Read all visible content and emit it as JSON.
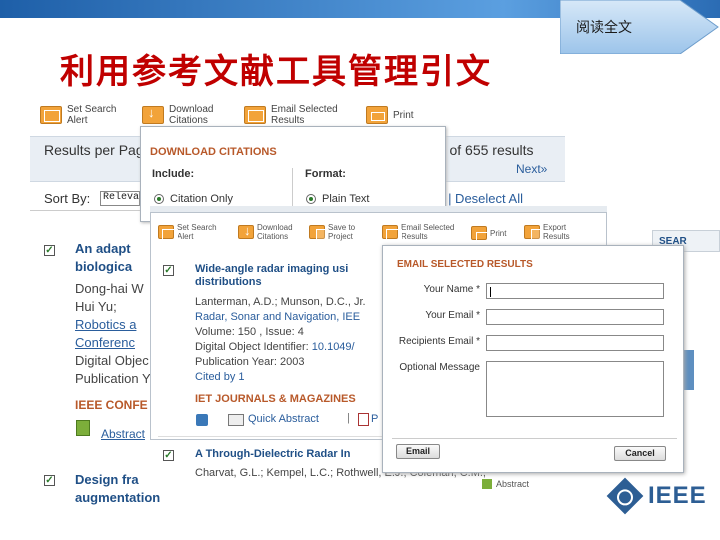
{
  "slide": {
    "title": "利用参考文献工具管理引文",
    "corner_link": "阅读全文"
  },
  "toolbar": {
    "set_search_alert": [
      "Set Search",
      "Alert"
    ],
    "download_citations": [
      "Download",
      "Citations"
    ],
    "email_selected": [
      "Email Selected",
      "Results"
    ],
    "print": "Print"
  },
  "results": {
    "per_page_label": "Results per Pag",
    "count_text": "25 of 655 results",
    "next": "Next»",
    "sort_label": "Sort By:",
    "sort_value": "Releva",
    "select_links_tail": "ge |  Deselect All",
    "items": [
      {
        "title_lines": [
          "An adapt",
          "biologica"
        ],
        "lines": [
          "Dong-hai W",
          "Hui Yu;"
        ],
        "links": [
          "Robotics a",
          "Conferenc"
        ],
        "extra": [
          "Digital Objec",
          "Publication Y"
        ],
        "conf": "IEEE CONFE",
        "abstract": "Abstract"
      },
      {
        "title_lines": [
          "Design fra",
          "augmentation"
        ],
        "abstract": "Abstract"
      }
    ]
  },
  "download_popup": {
    "heading": "DOWNLOAD CITATIONS",
    "include_label": "Include:",
    "format_label": "Format:",
    "include_value": "Citation Only",
    "format_value": "Plain Text"
  },
  "layer2": {
    "toolbar": {
      "set_search_alert": [
        "Set Search",
        "Alert"
      ],
      "download_citations": [
        "Download",
        "Citations"
      ],
      "save_to_project": [
        "Save to",
        "Project"
      ],
      "email_selected": [
        "Email Selected",
        "Results"
      ],
      "print": "Print",
      "export_results": [
        "Export",
        "Results"
      ]
    },
    "item1": {
      "title_lines": [
        "Wide-angle radar imaging usi",
        "distributions"
      ],
      "authors": "Lanterman, A.D.; Munson, D.C., Jr.",
      "journal": "Radar, Sonar and Navigation, IEE",
      "volume": "Volume: 150 , Issue: 4",
      "doi_label": "Digital Object Identifier: ",
      "doi_value": "10.1049/",
      "pubyear": "Publication Year: 2003",
      "cited": "Cited by 1",
      "journals": "IET JOURNALS & MAGAZINES",
      "quick_abstract": "Quick Abstract",
      "pdf_tail": "P"
    },
    "item2": {
      "title": "A Through-Dielectric Radar In",
      "authors": "Charvat, G.L.; Kempel, L.C.; Rothwell, E.J.; Coleman, C.M.;",
      "abstract_tail": "Abstract"
    },
    "search_tab": "SEAR"
  },
  "email_popup": {
    "heading": "EMAIL SELECTED RESULTS",
    "your_name_label": "Your Name *",
    "your_email_label": "Your Email *",
    "recipients_label": "Recipients Email *",
    "optional_label": "Optional Message",
    "email_button": "Email",
    "cancel_button": "Cancel"
  },
  "brand": {
    "logo_text": "IEEE"
  }
}
